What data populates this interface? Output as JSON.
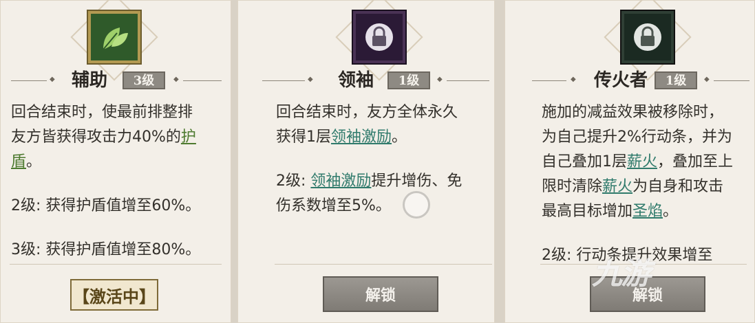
{
  "cards": [
    {
      "name": "辅助",
      "level": "3级",
      "icon": "leaf-icon",
      "desc_lines": [
        "回合结束时，使最前排整排",
        "友方皆获得攻击力40%的"
      ],
      "desc_kw1": "护",
      "desc_kw2": "盾",
      "desc_tail": "。",
      "lvl2": "2级: 获得护盾值增至60%。",
      "lvl3": "3级: 获得护盾值增至80%。",
      "status": "【激活中】"
    },
    {
      "name": "领袖",
      "level": "1级",
      "icon": "lock-icon",
      "line1": "回合结束时，友方全体永久",
      "line2_pre": "获得1层",
      "kw": "领袖激励",
      "line2_post": "。",
      "lvl2_pre": "2级: ",
      "lvl2_kw": "领袖激励",
      "lvl2_post": "提升增伤、免",
      "lvl2_line2": "伤系数增至5%。",
      "button": "解锁"
    },
    {
      "name": "传火者",
      "level": "1级",
      "icon": "lock-icon",
      "line1": "施加的减益效果被移除时，",
      "line2": "为自己提升2%行动条，并为",
      "line3_pre": "自己叠加1层",
      "kw1": "薪火",
      "line3_post": "，叠加至上",
      "line4_pre": "限时清除",
      "kw2": "薪火",
      "line4_post": "为自身和攻击",
      "line5_pre": "最高目标增加",
      "kw3": "圣焰",
      "line5_post": "。",
      "lvl2": "2级: 行动条提升效果增至",
      "button": "解锁"
    }
  ],
  "watermark": "九游"
}
